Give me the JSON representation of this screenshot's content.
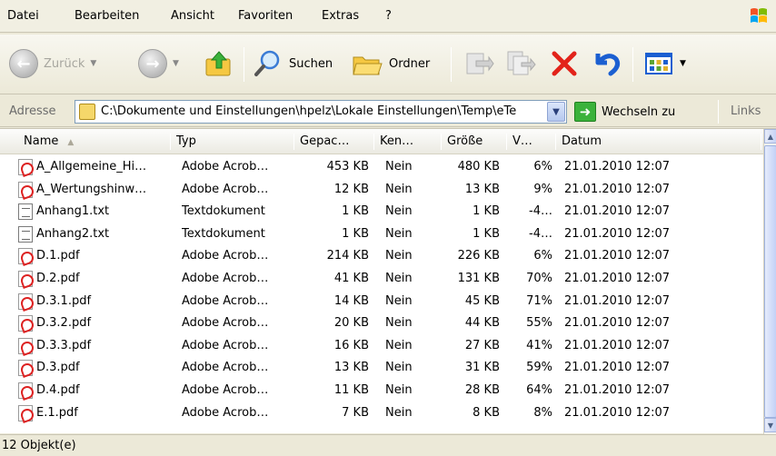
{
  "menu": {
    "items": [
      {
        "label": "Datei"
      },
      {
        "label": "Bearbeiten"
      },
      {
        "label": "Ansicht"
      },
      {
        "label": "Favoriten"
      },
      {
        "label": "Extras"
      },
      {
        "label": "?"
      }
    ]
  },
  "toolbar": {
    "back_label": "Zurück",
    "search_label": "Suchen",
    "folders_label": "Ordner"
  },
  "address": {
    "label": "Adresse",
    "path": "C:\\Dokumente und Einstellungen\\hpelz\\Lokale Einstellungen\\Temp\\eTe",
    "go_label": "Wechseln zu",
    "links_label": "Links"
  },
  "columns": [
    {
      "label": "Name"
    },
    {
      "label": "Typ"
    },
    {
      "label": "Gepac…"
    },
    {
      "label": "Ken…"
    },
    {
      "label": "Größe"
    },
    {
      "label": "V…"
    },
    {
      "label": "Datum"
    }
  ],
  "files": [
    {
      "name": "A_Allgemeine_Hi…",
      "icon": "pdf-icon",
      "typ": "Adobe Acrob…",
      "gepackt": "453 KB",
      "kennwort": "Nein",
      "groesse": "480 KB",
      "verhaeltnis": "6%",
      "datum": "21.01.2010 12:07"
    },
    {
      "name": "A_Wertungshinw…",
      "icon": "pdf-icon",
      "typ": "Adobe Acrob…",
      "gepackt": "12 KB",
      "kennwort": "Nein",
      "groesse": "13 KB",
      "verhaeltnis": "9%",
      "datum": "21.01.2010 12:07"
    },
    {
      "name": "Anhang1.txt",
      "icon": "text-file-icon",
      "typ": "Textdokument",
      "gepackt": "1 KB",
      "kennwort": "Nein",
      "groesse": "1 KB",
      "verhaeltnis": "-4…",
      "datum": "21.01.2010 12:07"
    },
    {
      "name": "Anhang2.txt",
      "icon": "text-file-icon",
      "typ": "Textdokument",
      "gepackt": "1 KB",
      "kennwort": "Nein",
      "groesse": "1 KB",
      "verhaeltnis": "-4…",
      "datum": "21.01.2010 12:07"
    },
    {
      "name": "D.1.pdf",
      "icon": "pdf-icon",
      "typ": "Adobe Acrob…",
      "gepackt": "214 KB",
      "kennwort": "Nein",
      "groesse": "226 KB",
      "verhaeltnis": "6%",
      "datum": "21.01.2010 12:07"
    },
    {
      "name": "D.2.pdf",
      "icon": "pdf-icon",
      "typ": "Adobe Acrob…",
      "gepackt": "41 KB",
      "kennwort": "Nein",
      "groesse": "131 KB",
      "verhaeltnis": "70%",
      "datum": "21.01.2010 12:07"
    },
    {
      "name": "D.3.1.pdf",
      "icon": "pdf-icon",
      "typ": "Adobe Acrob…",
      "gepackt": "14 KB",
      "kennwort": "Nein",
      "groesse": "45 KB",
      "verhaeltnis": "71%",
      "datum": "21.01.2010 12:07"
    },
    {
      "name": "D.3.2.pdf",
      "icon": "pdf-icon",
      "typ": "Adobe Acrob…",
      "gepackt": "20 KB",
      "kennwort": "Nein",
      "groesse": "44 KB",
      "verhaeltnis": "55%",
      "datum": "21.01.2010 12:07"
    },
    {
      "name": "D.3.3.pdf",
      "icon": "pdf-icon",
      "typ": "Adobe Acrob…",
      "gepackt": "16 KB",
      "kennwort": "Nein",
      "groesse": "27 KB",
      "verhaeltnis": "41%",
      "datum": "21.01.2010 12:07"
    },
    {
      "name": "D.3.pdf",
      "icon": "pdf-icon",
      "typ": "Adobe Acrob…",
      "gepackt": "13 KB",
      "kennwort": "Nein",
      "groesse": "31 KB",
      "verhaeltnis": "59%",
      "datum": "21.01.2010 12:07"
    },
    {
      "name": "D.4.pdf",
      "icon": "pdf-icon",
      "typ": "Adobe Acrob…",
      "gepackt": "11 KB",
      "kennwort": "Nein",
      "groesse": "28 KB",
      "verhaeltnis": "64%",
      "datum": "21.01.2010 12:07"
    },
    {
      "name": "E.1.pdf",
      "icon": "pdf-icon",
      "typ": "Adobe Acrob…",
      "gepackt": "7 KB",
      "kennwort": "Nein",
      "groesse": "8 KB",
      "verhaeltnis": "8%",
      "datum": "21.01.2010 12:07"
    }
  ],
  "status": {
    "text": "12 Objekt(e)"
  },
  "colors": {
    "window_bg": "#ece9d8",
    "delete_red": "#e2231a",
    "undo_blue": "#1b5fd1",
    "folder_yellow": "#f5c842",
    "go_green": "#3bb23b"
  }
}
